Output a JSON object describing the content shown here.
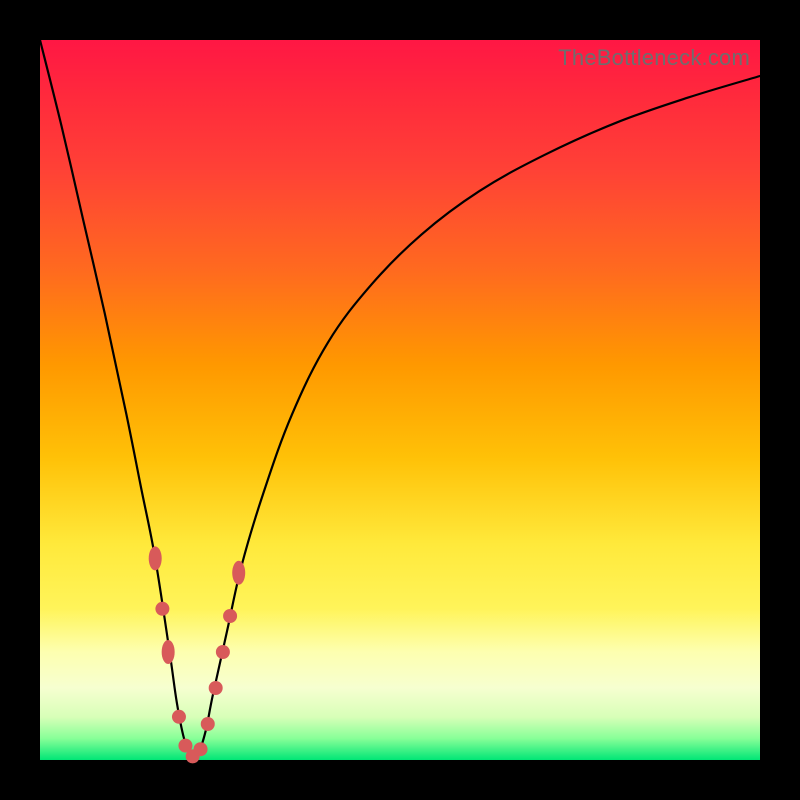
{
  "watermark": "TheBottleneck.com",
  "colors": {
    "frame": "#000000",
    "curve": "#000000",
    "marker": "#d85a5a",
    "gradient_top": "#ff1744",
    "gradient_mid": "#ffe93b",
    "gradient_bottom": "#00e676"
  },
  "chart_data": {
    "type": "line",
    "title": "",
    "xlabel": "",
    "ylabel": "",
    "xlim": [
      0,
      100
    ],
    "ylim": [
      0,
      100
    ],
    "grid": false,
    "legend": false,
    "note": "Axes are unlabeled in source; x/y are normalized 0–100. y≈100 at edges (red=bad), y≈0 at optimum (green=good). Minimum sits near x≈21.",
    "series": [
      {
        "name": "bottleneck-curve",
        "x": [
          0,
          3,
          6,
          9,
          12,
          14,
          16,
          18,
          19,
          20,
          21,
          22,
          23,
          24,
          26,
          28,
          31,
          35,
          40,
          46,
          53,
          61,
          70,
          80,
          90,
          100
        ],
        "y": [
          100,
          88,
          75,
          62,
          48,
          38,
          28,
          15,
          8,
          3,
          0.5,
          1,
          4,
          9,
          18,
          27,
          37,
          48,
          58,
          66,
          73,
          79,
          84,
          88.5,
          92,
          95
        ]
      }
    ],
    "markers": {
      "name": "highlighted-points",
      "note": "Salmon dots/oblongs clustered around the valley of the curve.",
      "points": [
        {
          "x": 16.0,
          "y": 28,
          "shape": "oblong"
        },
        {
          "x": 17.0,
          "y": 21,
          "shape": "dot"
        },
        {
          "x": 17.8,
          "y": 15,
          "shape": "oblong"
        },
        {
          "x": 19.3,
          "y": 6,
          "shape": "dot"
        },
        {
          "x": 20.2,
          "y": 2,
          "shape": "dot"
        },
        {
          "x": 21.2,
          "y": 0.5,
          "shape": "dot"
        },
        {
          "x": 22.3,
          "y": 1.5,
          "shape": "dot"
        },
        {
          "x": 23.3,
          "y": 5,
          "shape": "dot"
        },
        {
          "x": 24.4,
          "y": 10,
          "shape": "dot"
        },
        {
          "x": 25.4,
          "y": 15,
          "shape": "dot"
        },
        {
          "x": 26.4,
          "y": 20,
          "shape": "dot"
        },
        {
          "x": 27.6,
          "y": 26,
          "shape": "oblong"
        }
      ]
    }
  }
}
